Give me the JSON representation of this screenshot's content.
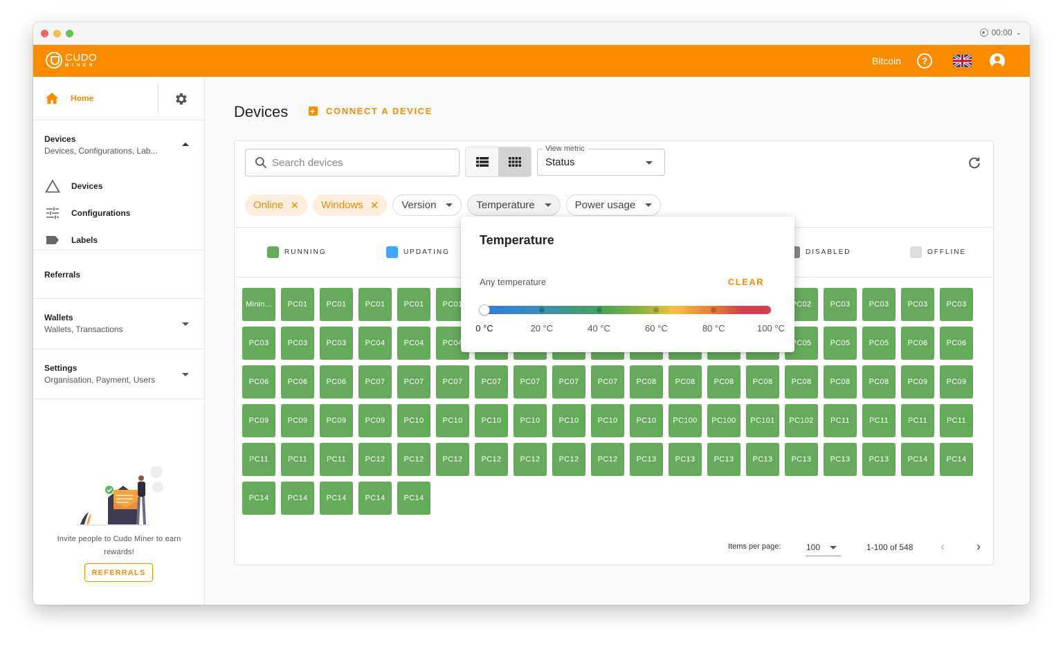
{
  "window": {
    "clock": "00:00"
  },
  "appbar": {
    "logo_text": "CUDO",
    "logo_sub": "MINER",
    "currency": "Bitcoin",
    "icons": [
      "help-icon",
      "uk-flag-icon",
      "account-icon"
    ]
  },
  "sidebar": {
    "home_label": "Home",
    "sections": [
      {
        "title": "Devices",
        "subtitle": "Devices, Configurations, Lab...",
        "expanded": true,
        "items": [
          {
            "label": "Devices",
            "icon": "triangle-icon"
          },
          {
            "label": "Configurations",
            "icon": "sliders-icon"
          },
          {
            "label": "Labels",
            "icon": "label-icon"
          }
        ]
      },
      {
        "title": "Referrals"
      },
      {
        "title": "Wallets",
        "subtitle": "Wallets, Transactions",
        "expanded": false
      },
      {
        "title": "Settings",
        "subtitle": "Organisation, Payment, Users",
        "expanded": false
      }
    ],
    "referral": {
      "text": "Invite people to Cudo Miner to earn rewards!",
      "button": "REFERRALS"
    }
  },
  "main": {
    "title": "Devices",
    "connect_label": "CONNECT A DEVICE",
    "search_placeholder": "Search devices",
    "view_mode": "grid",
    "metric_label": "View metric",
    "metric_value": "Status",
    "filters": [
      {
        "label": "Online",
        "active": true
      },
      {
        "label": "Windows",
        "active": true
      },
      {
        "label": "Version",
        "active": false
      },
      {
        "label": "Temperature",
        "active": false,
        "open": true
      },
      {
        "label": "Power usage",
        "active": false
      }
    ],
    "legend": [
      {
        "label": "RUNNING",
        "color": "#66ab5c"
      },
      {
        "label": "UPDATING",
        "color": "#42a5f5"
      },
      {
        "label": "DISABLED",
        "color": "#8a8a8a"
      },
      {
        "label": "OFFLINE",
        "color": "#dddddd"
      }
    ],
    "devices": [
      "Minin...",
      "PC01",
      "PC01",
      "PC01",
      "PC01",
      "PC01",
      "PC01",
      "PC01",
      "PC01",
      "PC02",
      "PC02",
      "PC02",
      "PC02",
      "PC02",
      "PC02",
      "PC03",
      "PC03",
      "PC03",
      "PC03",
      "PC03",
      "PC03",
      "PC03",
      "PC04",
      "PC04",
      "PC04",
      "PC04",
      "PC04",
      "PC04",
      "PC04",
      "PC05",
      "PC05",
      "PC05",
      "PC05",
      "PC05",
      "PC05",
      "PC05",
      "PC06",
      "PC06",
      "PC06",
      "PC06",
      "PC06",
      "PC07",
      "PC07",
      "PC07",
      "PC07",
      "PC07",
      "PC07",
      "PC07",
      "PC08",
      "PC08",
      "PC08",
      "PC08",
      "PC08",
      "PC08",
      "PC08",
      "PC09",
      "PC09",
      "PC09",
      "PC09",
      "PC09",
      "PC09",
      "PC10",
      "PC10",
      "PC10",
      "PC10",
      "PC10",
      "PC10",
      "PC10",
      "PC100",
      "PC100",
      "PC101",
      "PC102",
      "PC11",
      "PC11",
      "PC11",
      "PC11",
      "PC11",
      "PC11",
      "PC11",
      "PC12",
      "PC12",
      "PC12",
      "PC12",
      "PC12",
      "PC12",
      "PC12",
      "PC13",
      "PC13",
      "PC13",
      "PC13",
      "PC13",
      "PC13",
      "PC13",
      "PC14",
      "PC14",
      "PC14",
      "PC14",
      "PC14",
      "PC14",
      "PC14"
    ],
    "device_status": "running",
    "pagination": {
      "items_per_page_label": "Items per page:",
      "items_per_page": "100",
      "range": "1-100 of 548"
    }
  },
  "temperature_popover": {
    "title": "Temperature",
    "current": "Any temperature",
    "clear_label": "CLEAR",
    "min": 0,
    "max": 100,
    "value": 0,
    "ticks": [
      "0 °C",
      "20 °C",
      "40 °C",
      "60 °C",
      "80 °C",
      "100 °C"
    ]
  }
}
